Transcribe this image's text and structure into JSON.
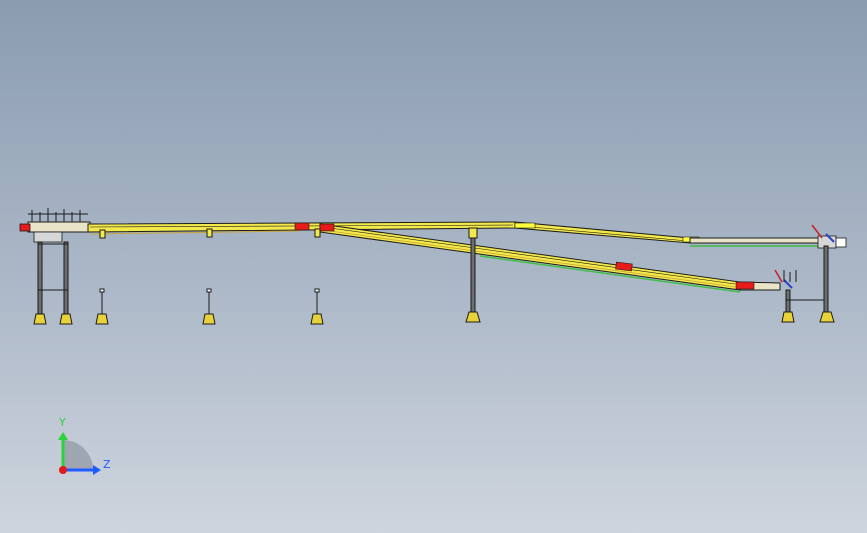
{
  "view": {
    "type": "cad-side-elevation",
    "background_top": "#8b9cb0",
    "background_bottom": "#cfd5de"
  },
  "triad": {
    "y_label": "Y",
    "z_label": "Z",
    "y_color": "#2bd23a",
    "z_color": "#1f5bff",
    "origin_color": "#e01919"
  },
  "colors": {
    "frame": "#1b1b1b",
    "rail_fill": "#f3e94a",
    "rail_accent": "#ffff40",
    "guide_green": "#3fbf46",
    "motor_red": "#e81b1b",
    "foot_fill": "#e8d23a",
    "valve_red": "#c62020",
    "valve_blue": "#2a44c8"
  },
  "components": {
    "upper_conveyor": "upper-conveyor-line",
    "lower_conveyor": "lower-incline-conveyor",
    "support_legs": 10,
    "drive_units": 4
  }
}
